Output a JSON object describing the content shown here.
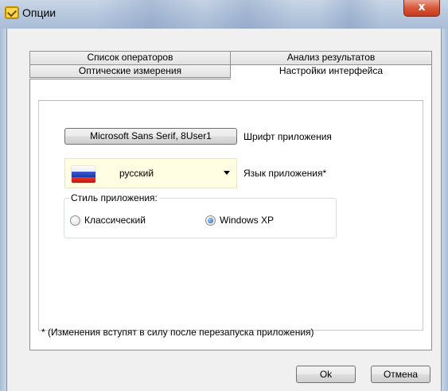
{
  "window": {
    "title": "Опции",
    "close_label": "x"
  },
  "tabs": [
    {
      "label": "Список операторов"
    },
    {
      "label": "Анализ результатов"
    },
    {
      "label": "Оптические измерения"
    },
    {
      "label": "Настройки интерфейса",
      "active": true
    }
  ],
  "font": {
    "button_label": "Microsoft Sans Serif, 8User1",
    "label": "Шрифт приложения"
  },
  "language": {
    "selected": "русский",
    "label": "Язык приложения*"
  },
  "style": {
    "legend": "Стиль приложения:",
    "options": [
      {
        "label": "Классический",
        "checked": false
      },
      {
        "label": "Windows XP",
        "checked": true
      }
    ]
  },
  "note": "* (Изменения вступят в силу после перезапуска приложения)",
  "buttons": {
    "ok": "Ok",
    "cancel": "Отмена"
  },
  "colors": {
    "title_bar": "#b9cadf",
    "close_button": "#d9573b",
    "select_bg": "#fffde2",
    "radio_selected": "#1a5fb4"
  }
}
